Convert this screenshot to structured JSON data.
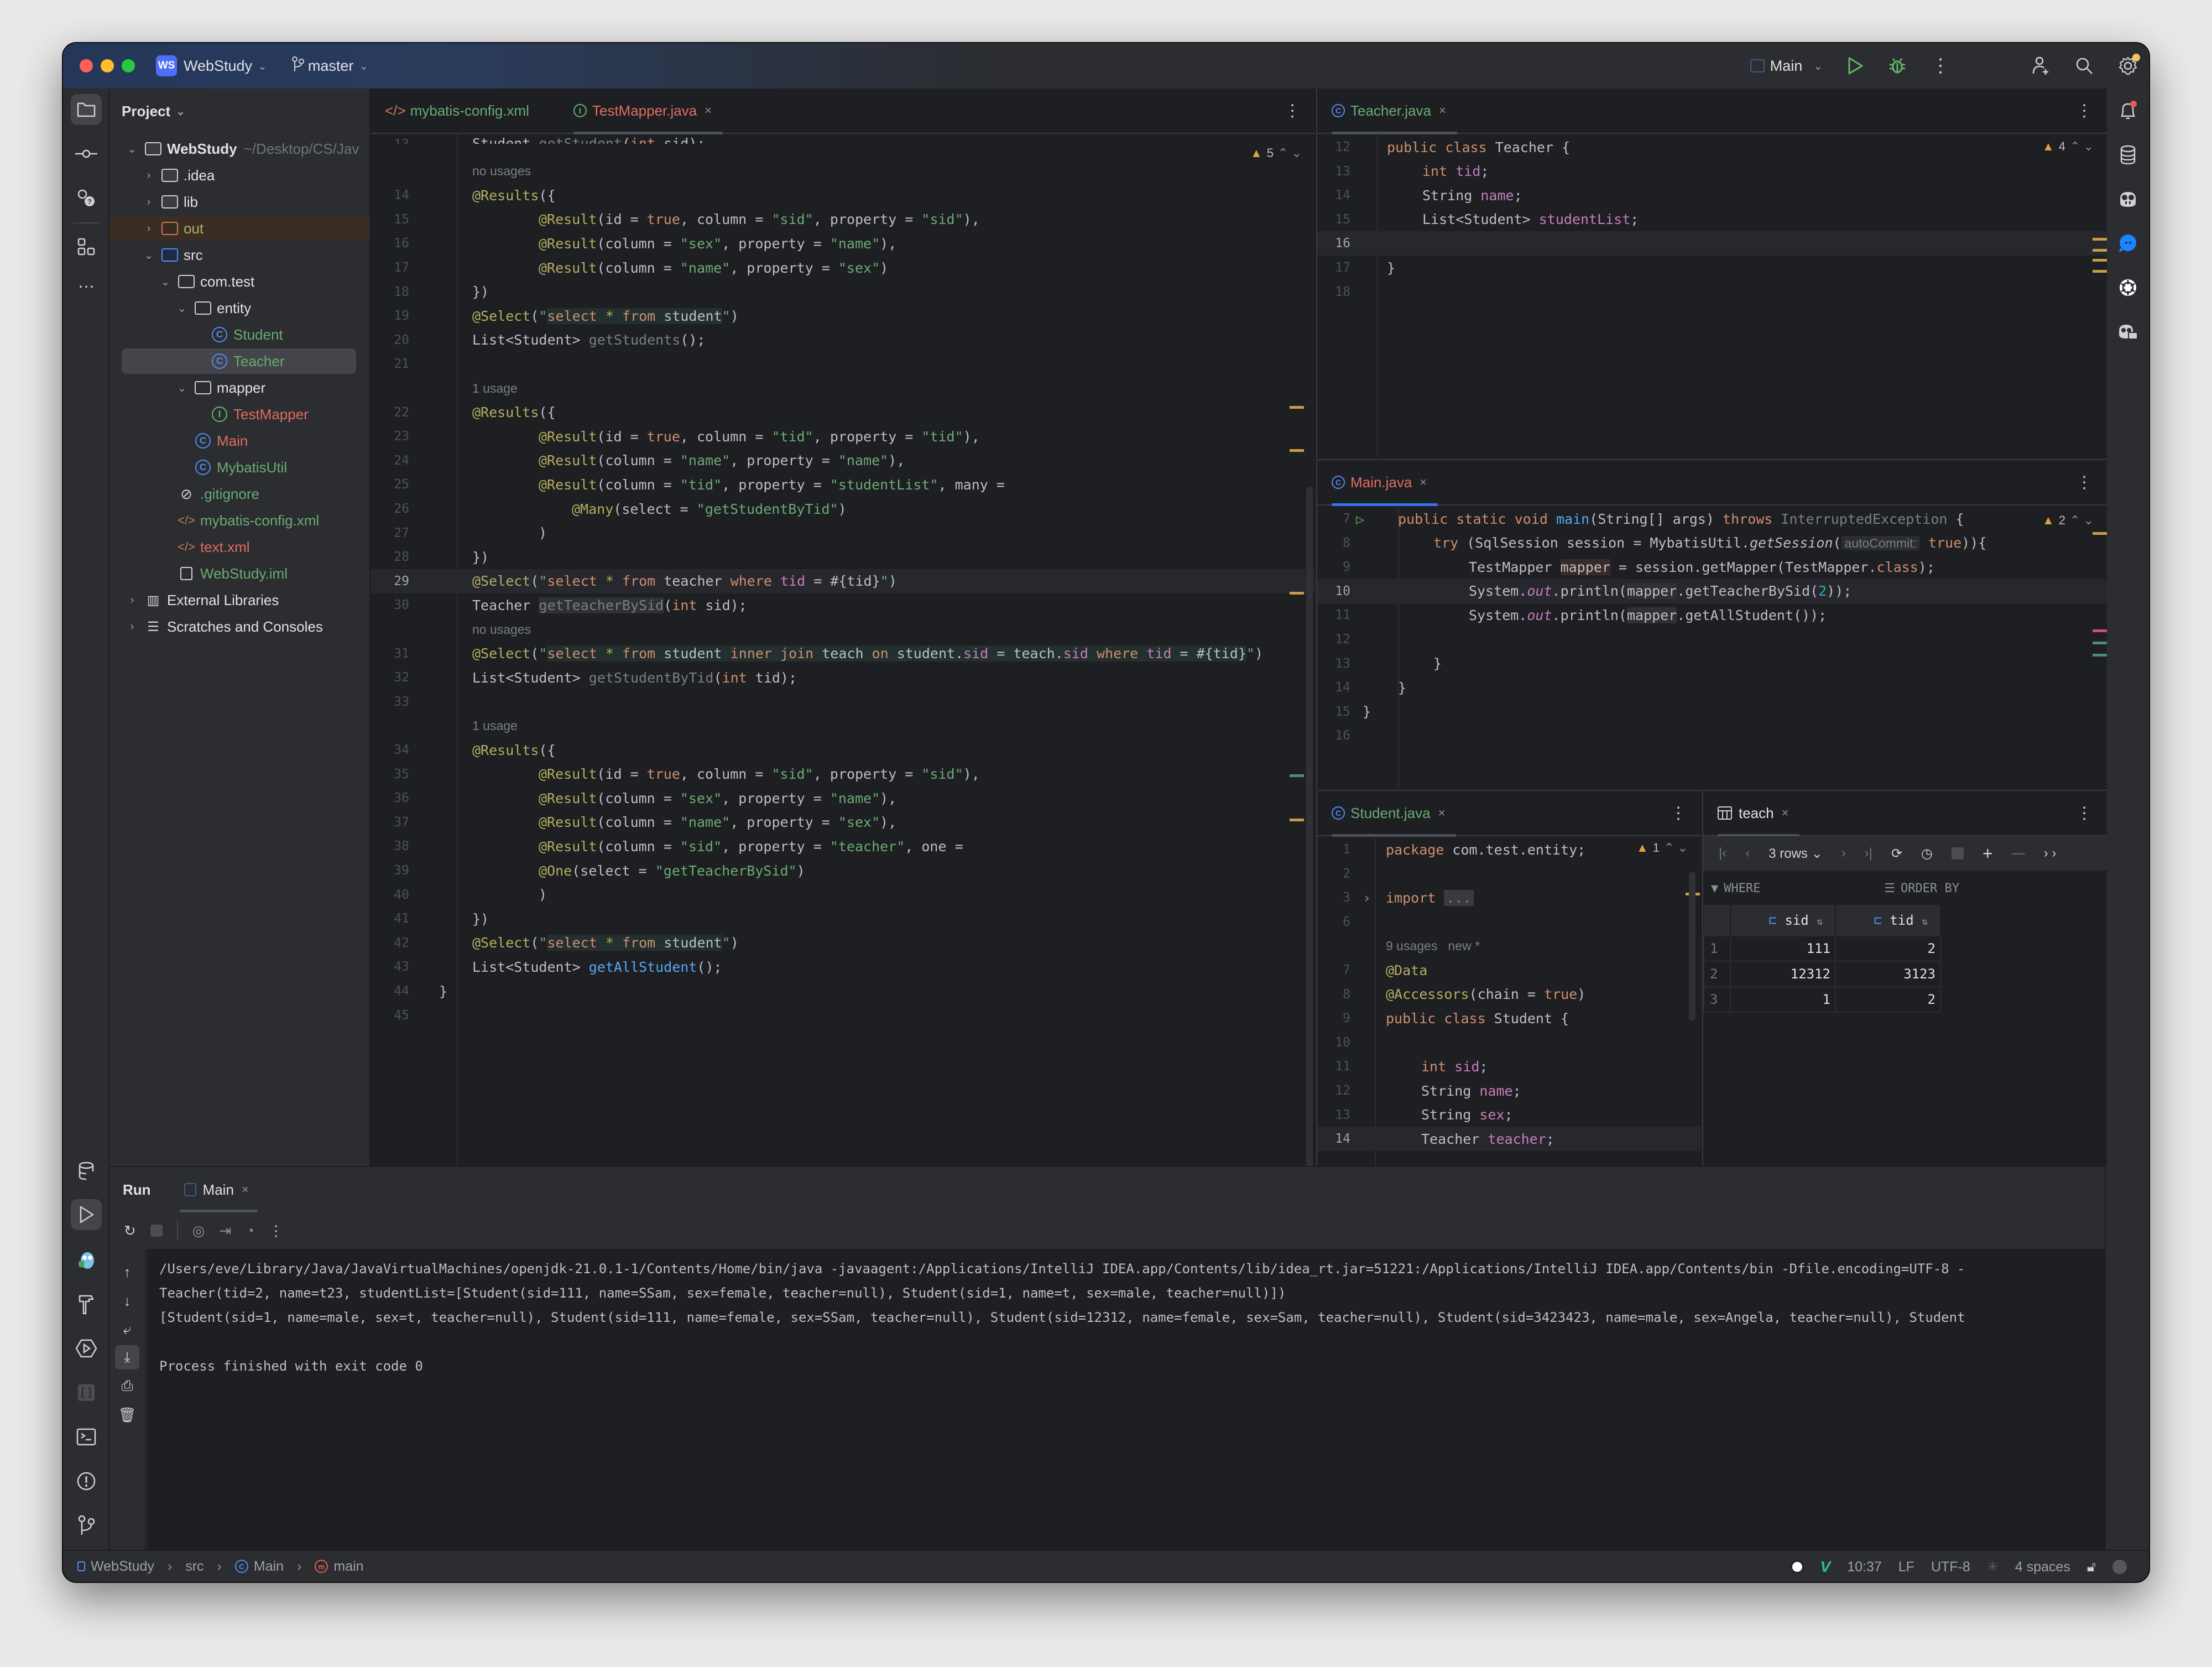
{
  "titlebar": {
    "project_badge": "WS",
    "project_name": "WebStudy",
    "branch": "master",
    "run_config": "Main"
  },
  "project_panel": {
    "title": "Project",
    "tree": [
      {
        "label": "WebStudy",
        "suffix": "~/Desktop/CS/Jav",
        "kind": "project",
        "depth": 0,
        "expanded": true
      },
      {
        "label": ".idea",
        "kind": "folder",
        "depth": 1,
        "expanded": false
      },
      {
        "label": "lib",
        "kind": "folder",
        "depth": 1,
        "expanded": false
      },
      {
        "label": "out",
        "kind": "folder-out",
        "depth": 1,
        "expanded": false
      },
      {
        "label": "src",
        "kind": "folder-src",
        "depth": 1,
        "expanded": true
      },
      {
        "label": "com.test",
        "kind": "package",
        "depth": 2,
        "expanded": true
      },
      {
        "label": "entity",
        "kind": "package",
        "depth": 3,
        "expanded": true
      },
      {
        "label": "Student",
        "kind": "class",
        "depth": 4
      },
      {
        "label": "Teacher",
        "kind": "class",
        "depth": 4,
        "selected": true
      },
      {
        "label": "mapper",
        "kind": "package",
        "depth": 3,
        "expanded": true
      },
      {
        "label": "TestMapper",
        "kind": "interface",
        "depth": 4
      },
      {
        "label": "Main",
        "kind": "class",
        "depth": 3
      },
      {
        "label": "MybatisUtil",
        "kind": "class",
        "depth": 3
      },
      {
        "label": ".gitignore",
        "kind": "ignore",
        "depth": 2
      },
      {
        "label": "mybatis-config.xml",
        "kind": "xml",
        "depth": 2
      },
      {
        "label": "text.xml",
        "kind": "xml",
        "depth": 2
      },
      {
        "label": "WebStudy.iml",
        "kind": "iml",
        "depth": 2
      },
      {
        "label": "External Libraries",
        "kind": "libs",
        "depth": 0,
        "expanded": false
      },
      {
        "label": "Scratches and Consoles",
        "kind": "scratches",
        "depth": 0,
        "expanded": false
      }
    ]
  },
  "left_editor": {
    "tabs": [
      {
        "label": "mybatis-config.xml",
        "icon": "xml-icon"
      },
      {
        "label": "TestMapper.java",
        "icon": "interface-icon",
        "selected": true
      }
    ],
    "warnings": "5",
    "lines": [
      {
        "n": "13",
        "html": "<span class='t'>Student </span><span class='u'>getStudent</span><span class='t'>(</span><span class='k'>int</span><span class='t'> sid);</span>",
        "ind": 1,
        "clip": true
      },
      {
        "n": "",
        "hint": "no usages",
        "ind": 1
      },
      {
        "n": "14",
        "html": "<span class='a'>@Results</span><span class='t'>({</span>",
        "ind": 1
      },
      {
        "n": "15",
        "html": "<span class='a'>@Result</span><span class='t'>(id = </span><span class='k'>true</span><span class='t'>, column = </span><span class='s'>\"sid\"</span><span class='t'>, property = </span><span class='s'>\"sid\"</span><span class='t'>),</span>",
        "ind": 3
      },
      {
        "n": "16",
        "html": "<span class='a'>@Result</span><span class='t'>(column = </span><span class='s'>\"sex\"</span><span class='t'>, property = </span><span class='s'>\"name\"</span><span class='t'>),</span>",
        "ind": 3
      },
      {
        "n": "17",
        "html": "<span class='a'>@Result</span><span class='t'>(column = </span><span class='s'>\"name\"</span><span class='t'>, property = </span><span class='s'>\"sex\"</span><span class='t'>)</span>",
        "ind": 3
      },
      {
        "n": "18",
        "html": "<span class='t'>})</span>",
        "ind": 1
      },
      {
        "n": "19",
        "html": "<span class='a'>@Select</span><span class='t'>(</span><span class='s'>\"</span><span class='sqlbg'><span class='k'>select</span> <span class='a'>*</span> <span class='k'>from</span><span class='t'> student</span></span><span class='s'>\"</span><span class='t'>)</span>",
        "ind": 1
      },
      {
        "n": "20",
        "html": "<span class='t'>List&lt;Student&gt; </span><span class='u'>getStudents</span><span class='t'>();</span>",
        "ind": 1
      },
      {
        "n": "21",
        "html": "",
        "ind": 1
      },
      {
        "n": "",
        "hint": "1 usage",
        "ind": 1
      },
      {
        "n": "22",
        "html": "<span class='a'>@Results</span><span class='t'>({</span>",
        "ind": 1
      },
      {
        "n": "23",
        "html": "<span class='a'>@Result</span><span class='t'>(id = </span><span class='k'>true</span><span class='t'>, column = </span><span class='s'>\"tid\"</span><span class='t'>, property = </span><span class='s'>\"tid\"</span><span class='t'>),</span>",
        "ind": 3
      },
      {
        "n": "24",
        "html": "<span class='a'>@Result</span><span class='t'>(column = </span><span class='s'>\"name\"</span><span class='t'>, property = </span><span class='s'>\"name\"</span><span class='t'>),</span>",
        "ind": 3
      },
      {
        "n": "25",
        "html": "<span class='a'>@Result</span><span class='t'>(column = </span><span class='s'>\"tid\"</span><span class='t'>, property = </span><span class='s'>\"studentList\"</span><span class='t'>, many =</span>",
        "ind": 3
      },
      {
        "n": "26",
        "html": "<span class='a'>@Many</span><span class='t'>(select = </span><span class='s'>\"getStudentByTid\"</span><span class='t'>)</span>",
        "ind": 4
      },
      {
        "n": "27",
        "html": "<span class='t'>)</span>",
        "ind": 3
      },
      {
        "n": "28",
        "html": "<span class='t'>})</span>",
        "ind": 1
      },
      {
        "n": "29",
        "html": "<span class='a'>@Select</span><span class='t'>(</span><span class='s'>\"</span><span class='k'>select</span> <span class='a'>*</span> <span class='k'>from</span><span class='t'> teacher </span><span class='k'>where</span> <span class='f'>tid</span><span class='t'> = #{tid}</span><span class='s'>\"</span><span class='t'>)</span>",
        "ind": 1,
        "current": true
      },
      {
        "n": "30",
        "html": "<span class='t'>Teacher </span><span class='u' style='background:#2f3133'>getTeacherBySid</span><span class='t'>(</span><span class='k'>int</span><span class='t'> sid);</span>",
        "ind": 1
      },
      {
        "n": "",
        "hint": "no usages",
        "ind": 1
      },
      {
        "n": "31",
        "html": "<span class='a'>@Select</span><span class='t'>(</span><span class='s'>\"</span><span class='sqlbg'><span class='k'>select</span> <span class='a'>*</span> <span class='k'>from</span><span class='t'> student </span><span class='k'>inner join</span><span class='t'> teach </span><span class='k'>on</span><span class='t'> student.</span><span class='f'>sid</span><span class='t'> = teach.</span><span class='f'>sid</span> <span class='k'>where</span> <span class='f'>tid</span><span class='t'> = #{tid}</span></span><span class='s'>\"</span><span class='t'>)</span>",
        "ind": 1
      },
      {
        "n": "32",
        "html": "<span class='t'>List&lt;Student&gt; </span><span class='u'>getStudentByTid</span><span class='t'>(</span><span class='k'>int</span><span class='t'> tid);</span>",
        "ind": 1
      },
      {
        "n": "33",
        "html": "",
        "ind": 1
      },
      {
        "n": "",
        "hint": "1 usage",
        "ind": 1
      },
      {
        "n": "34",
        "html": "<span class='a'>@Results</span><span class='t'>({</span>",
        "ind": 1
      },
      {
        "n": "35",
        "html": "<span class='a'>@Result</span><span class='t'>(id = </span><span class='k'>true</span><span class='t'>, column = </span><span class='s'>\"sid\"</span><span class='t'>, property = </span><span class='s'>\"sid\"</span><span class='t'>),</span>",
        "ind": 3
      },
      {
        "n": "36",
        "html": "<span class='a'>@Result</span><span class='t'>(column = </span><span class='s'>\"sex\"</span><span class='t'>, property = </span><span class='s'>\"name\"</span><span class='t'>),</span>",
        "ind": 3
      },
      {
        "n": "37",
        "html": "<span class='a'>@Result</span><span class='t'>(column = </span><span class='s'>\"name\"</span><span class='t'>, property = </span><span class='s'>\"sex\"</span><span class='t'>),</span>",
        "ind": 3
      },
      {
        "n": "38",
        "html": "<span class='a'>@Result</span><span class='t'>(column = </span><span class='s'>\"sid\"</span><span class='t'>, property = </span><span class='s'>\"teacher\"</span><span class='t'>, one =</span>",
        "ind": 3
      },
      {
        "n": "39",
        "html": "<span class='a'>@One</span><span class='t'>(select = </span><span class='s'>\"getTeacherBySid\"</span><span class='t'>)</span>",
        "ind": 3
      },
      {
        "n": "40",
        "html": "<span class='t'>)</span>",
        "ind": 3
      },
      {
        "n": "41",
        "html": "<span class='t'>})</span>",
        "ind": 1
      },
      {
        "n": "42",
        "html": "<span class='a'>@Select</span><span class='t'>(</span><span class='s'>\"</span><span class='sqlbg'><span class='k'>select</span> <span class='a'>*</span> <span class='k'>from</span><span class='t'> student</span></span><span class='s'>\"</span><span class='t'>)</span>",
        "ind": 1
      },
      {
        "n": "43",
        "html": "<span class='t'>List&lt;Student&gt; </span><span class='m'>getAllStudent</span><span class='t'>();</span>",
        "ind": 1
      },
      {
        "n": "44",
        "html": "<span class='t'>}</span>",
        "ind": 0
      },
      {
        "n": "45",
        "html": "",
        "ind": 0
      }
    ]
  },
  "teacher_editor": {
    "tab": "Teacher.java",
    "warnings": "4",
    "lines": [
      {
        "n": "12",
        "html": "<span class='k'>public class</span><span class='t'> Teacher {</span>",
        "ind": 0
      },
      {
        "n": "13",
        "html": "<span class='k'>int</span> <span class='f'>tid</span><span class='t'>;</span>",
        "ind": 1
      },
      {
        "n": "14",
        "html": "<span class='t'>String </span><span class='f'>name</span><span class='t'>;</span>",
        "ind": 1
      },
      {
        "n": "15",
        "html": "<span class='t'>List&lt;Student&gt; </span><span class='f'>studentList</span><span class='t'>;</span>",
        "ind": 1
      },
      {
        "n": "16",
        "html": "",
        "ind": 1,
        "current": true
      },
      {
        "n": "17",
        "html": "<span class='t'>}</span>",
        "ind": 0
      },
      {
        "n": "18",
        "html": "",
        "ind": 0
      }
    ]
  },
  "main_editor": {
    "tab": "Main.java",
    "warnings": "2",
    "inlay_hint": "autoCommit:",
    "lines": [
      {
        "n": "7",
        "html": "<span class='k'>public static void</span> <span class='m'>main</span><span class='t'>(String[] args) </span><span class='k'>throws</span> <span class='u'>InterruptedException</span><span class='t'> {</span>",
        "ind": 1,
        "run": true
      },
      {
        "n": "8",
        "html": "<span class='k'>try</span><span class='t'> (SqlSession session = MybatisUtil.</span><span class='t' style='font-style:italic'>getSession</span><span class='t'>(</span><span class='hint' style='background:#2b2d30;border-radius:6px;padding:0 6px'>autoCommit:</span><span class='k'> true</span><span class='t'>)){</span>",
        "ind": 2
      },
      {
        "n": "9",
        "html": "<span class='t'>TestMapper </span><span class='t' style='background:#3a2b2b'>mapper</span><span class='t'> = session.getMapper(TestMapper.</span><span class='k'>class</span><span class='t'>);</span>",
        "ind": 3
      },
      {
        "n": "10",
        "html": "<span class='t'>System.</span><span class='f' style='font-style:italic'>out</span><span class='t'>.println(</span><span class='t' style='background:#2f3133'>mapper</span><span class='t'>.getTeacherBySid(</span><span class='n'>2</span><span class='t'>));</span>",
        "ind": 3,
        "current": true
      },
      {
        "n": "11",
        "html": "<span class='t'>System.</span><span class='f' style='font-style:italic'>out</span><span class='t'>.println(</span><span class='t' style='background:#2f3133'>mapper</span><span class='t'>.getAllStudent());</span>",
        "ind": 3
      },
      {
        "n": "12",
        "html": "",
        "ind": 3
      },
      {
        "n": "13",
        "html": "<span class='t'>}</span>",
        "ind": 2
      },
      {
        "n": "14",
        "html": "<span class='t'>}</span>",
        "ind": 1
      },
      {
        "n": "15",
        "html": "<span class='t'>}</span>",
        "ind": 0
      },
      {
        "n": "16",
        "html": "",
        "ind": 0
      }
    ]
  },
  "student_editor": {
    "tab": "Student.java",
    "warnings": "1",
    "lines": [
      {
        "n": "1",
        "html": "<span class='k'>package</span><span class='t'> com.test.entity;</span>",
        "ind": 0
      },
      {
        "n": "2",
        "html": "",
        "ind": 0
      },
      {
        "n": "3",
        "html": "<span class='k'>import</span> <span class='u' style='background:#393b40;padding:0 4px'>...</span>",
        "ind": 0,
        "fold": true
      },
      {
        "n": "6",
        "html": "",
        "ind": 0
      },
      {
        "n": "",
        "hint": "9 usages   new *",
        "ind": 0
      },
      {
        "n": "7",
        "html": "<span class='a'>@Data</span>",
        "ind": 0
      },
      {
        "n": "8",
        "html": "<span class='a'>@Accessors</span><span class='t'>(chain = </span><span class='k'>true</span><span class='t'>)</span>",
        "ind": 0
      },
      {
        "n": "9",
        "html": "<span class='k'>public class</span><span class='t'> Student {</span>",
        "ind": 0
      },
      {
        "n": "10",
        "html": "",
        "ind": 0
      },
      {
        "n": "11",
        "html": "<span class='k'>int</span> <span class='f'>sid</span><span class='t'>;</span>",
        "ind": 1
      },
      {
        "n": "12",
        "html": "<span class='t'>String </span><span class='f'>name</span><span class='t'>;</span>",
        "ind": 1
      },
      {
        "n": "13",
        "html": "<span class='t'>String </span><span class='f'>sex</span><span class='t'>;</span>",
        "ind": 1
      },
      {
        "n": "14",
        "html": "<span class='t'>Teacher </span><span class='f'>teacher</span><span class='t'>;</span>",
        "ind": 1,
        "current": true
      }
    ]
  },
  "table_viewer": {
    "tab": "teach",
    "rows_label": "3 rows",
    "where_label": "WHERE",
    "order_label": "ORDER BY",
    "columns": [
      "sid",
      "tid"
    ],
    "rows": [
      [
        "1",
        "111",
        "2"
      ],
      [
        "2",
        "12312",
        "3123"
      ],
      [
        "3",
        "1",
        "2"
      ]
    ]
  },
  "run_panel": {
    "title": "Run",
    "tab": "Main",
    "console": [
      "/Users/eve/Library/Java/JavaVirtualMachines/openjdk-21.0.1-1/Contents/Home/bin/java -javaagent:/Applications/IntelliJ IDEA.app/Contents/lib/idea_rt.jar=51221:/Applications/IntelliJ IDEA.app/Contents/bin -Dfile.encoding=UTF-8 -",
      "Teacher(tid=2, name=t23, studentList=[Student(sid=111, name=SSam, sex=female, teacher=null), Student(sid=1, name=t, sex=male, teacher=null)])",
      "[Student(sid=1, name=male, sex=t, teacher=null), Student(sid=111, name=female, sex=SSam, teacher=null), Student(sid=12312, name=female, sex=Sam, teacher=null), Student(sid=3423423, name=male, sex=Angela, teacher=null), Student",
      "",
      "Process finished with exit code 0"
    ]
  },
  "statusbar": {
    "breadcrumb": [
      "WebStudy",
      "src",
      "Main",
      "main"
    ],
    "position": "10:37",
    "line_sep": "LF",
    "encoding": "UTF-8",
    "indent": "4 spaces"
  }
}
